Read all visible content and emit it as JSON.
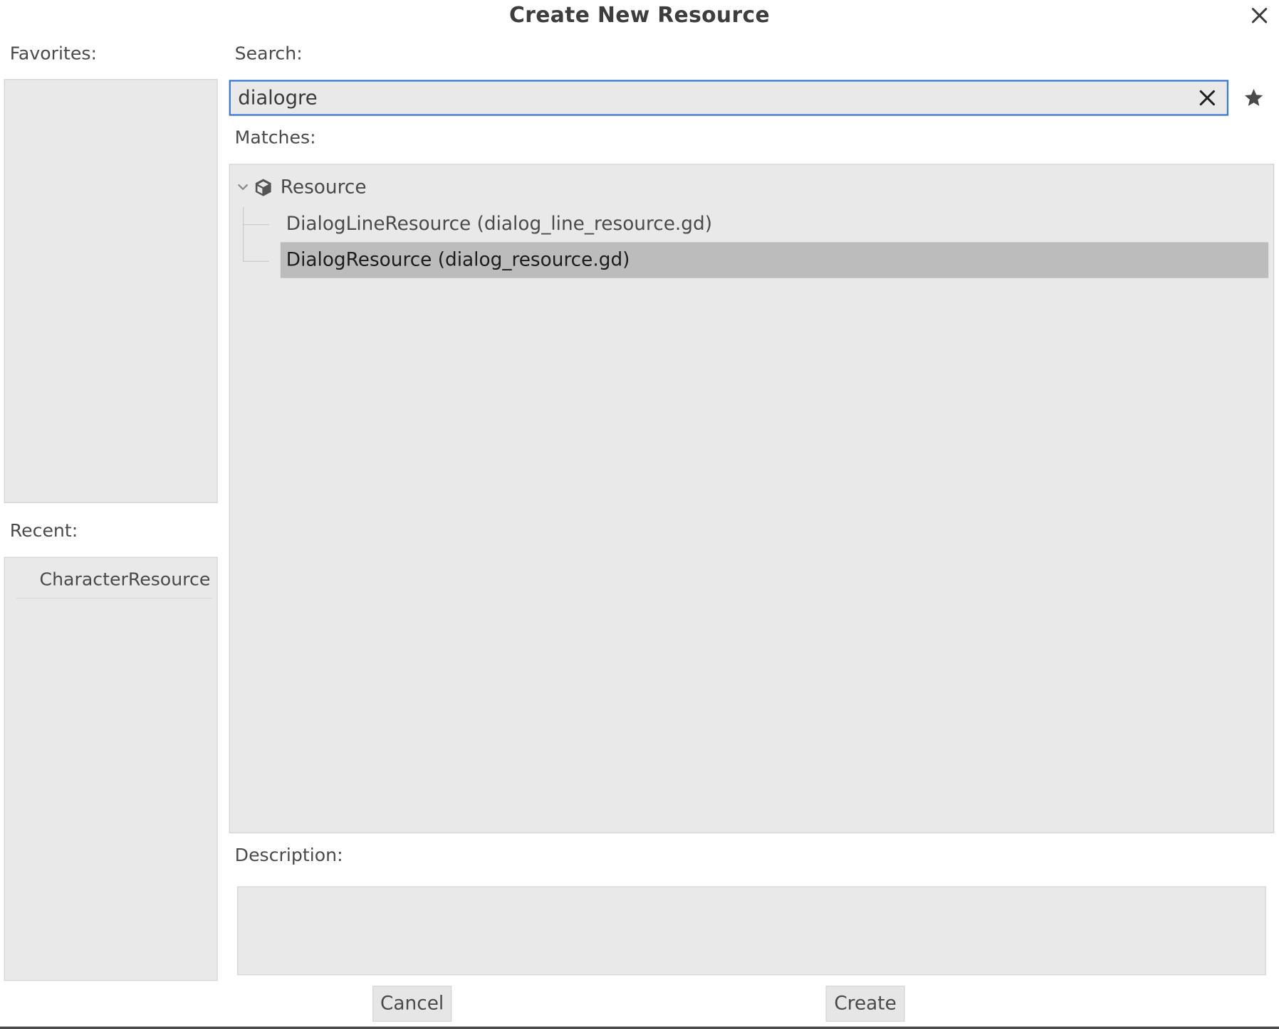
{
  "dialog": {
    "title": "Create New Resource"
  },
  "favorites": {
    "label": "Favorites:",
    "items": []
  },
  "recent": {
    "label": "Recent:",
    "items": [
      "CharacterResource"
    ]
  },
  "search": {
    "label": "Search:",
    "value": "dialogre"
  },
  "matches": {
    "label": "Matches:",
    "root": {
      "label": "Resource",
      "icon": "resource-cube-icon",
      "expanded": true
    },
    "children": [
      "DialogLineResource (dialog_line_resource.gd)",
      "DialogResource (dialog_resource.gd)"
    ],
    "selected_index": 1
  },
  "description": {
    "label": "Description:",
    "text": ""
  },
  "buttons": {
    "cancel": "Cancel",
    "create": "Create"
  },
  "colors": {
    "accent": "#3b78d8",
    "panel_bg": "#e9e9e9",
    "selected_bg": "#bcbcbc",
    "text": "#4a4a4a"
  }
}
